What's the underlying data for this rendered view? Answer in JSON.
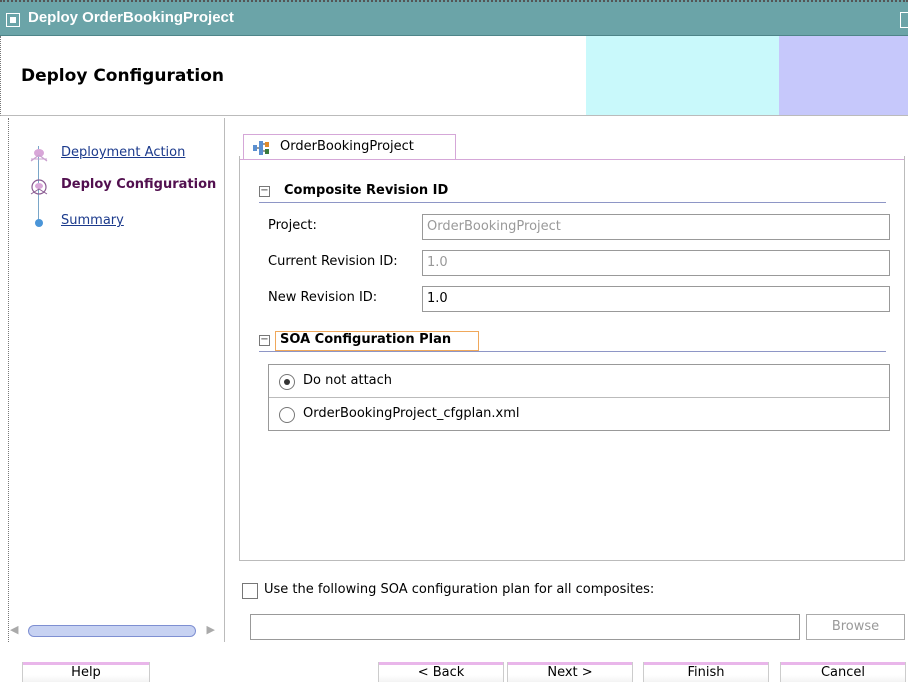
{
  "window": {
    "title": "Deploy OrderBookingProject"
  },
  "header": {
    "title": "Deploy Configuration"
  },
  "steps": [
    {
      "label": "Deployment Action",
      "state": "link"
    },
    {
      "label": "Deploy Configuration",
      "state": "current"
    },
    {
      "label": "Summary",
      "state": "link"
    }
  ],
  "tab": {
    "label": "OrderBookingProject"
  },
  "composite_section": {
    "title": "Composite Revision ID",
    "project_label": "Project:",
    "project_value": "OrderBookingProject",
    "current_revision_label": "Current Revision ID:",
    "current_revision_value": "1.0",
    "new_revision_label": "New Revision ID:",
    "new_revision_value": "1.0"
  },
  "soa_section": {
    "title": "SOA Configuration Plan",
    "options": [
      {
        "label": "Do not attach",
        "checked": true
      },
      {
        "label": "OrderBookingProject_cfgplan.xml",
        "checked": false
      }
    ]
  },
  "plan_all": {
    "label": "Use the following SOA configuration plan for all composites:",
    "checked": false,
    "value": "",
    "browse_label": "Browse"
  },
  "buttons": {
    "help": "Help",
    "back": "< Back",
    "next": "Next >",
    "finish": "Finish",
    "cancel": "Cancel"
  },
  "colors": {
    "titlebar": "#6ba4a8",
    "band_cyan": "#c9f9fb",
    "band_lavender": "#c6c8fb",
    "current_step": "#52104f",
    "link": "#1b3a8c"
  }
}
